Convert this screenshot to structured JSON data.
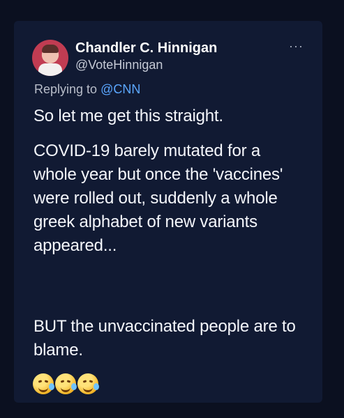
{
  "tweet": {
    "author": {
      "name": "Chandler C. Hinnigan",
      "handle": "@VoteHinnigan"
    },
    "more_label": "···",
    "reply": {
      "prefix": "Replying to ",
      "mention": "@CNN"
    },
    "body": {
      "line1": "So let me get this straight.",
      "para2": "COVID-19 barely mutated for a whole year but once the 'vaccines' were rolled out, suddenly a whole greek alphabet of new variants appeared...",
      "para3": "BUT the unvaccinated people are to blame."
    },
    "emojis": [
      "rolling-on-floor-laughing-icon",
      "rolling-on-floor-laughing-icon",
      "rolling-on-floor-laughing-icon"
    ],
    "colors": {
      "background": "#0b1020",
      "card": "#111a33",
      "link": "#5ba7ff",
      "text": "#f4f6fb"
    }
  }
}
